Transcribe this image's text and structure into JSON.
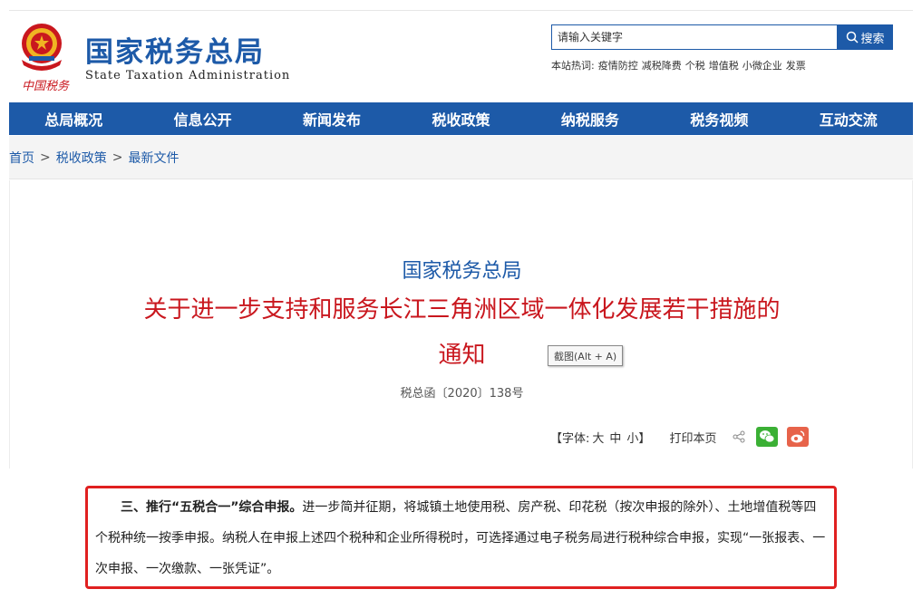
{
  "header": {
    "title_cn": "国家税务总局",
    "title_en": "State Taxation Administration",
    "emblem_caption": "中国税务"
  },
  "search": {
    "placeholder": "请输入关键字",
    "button_label": "搜索",
    "hot_label": "本站热词:",
    "hot_words": [
      "疫情防控",
      "减税降费",
      "个税",
      "增值税",
      "小微企业",
      "发票"
    ]
  },
  "nav": {
    "items": [
      "总局概况",
      "信息公开",
      "新闻发布",
      "税收政策",
      "纳税服务",
      "税务视频",
      "互动交流"
    ]
  },
  "breadcrumb": {
    "items": [
      "首页",
      "税收政策",
      "最新文件"
    ],
    "separator": ">"
  },
  "article": {
    "issuer": "国家税务总局",
    "title": "关于进一步支持和服务长江三角洲区域一体化发展若干措施的通知",
    "doc_number": "税总函〔2020〕138号",
    "tooltip": "截图(Alt + A)"
  },
  "tools": {
    "font_label": "【字体:",
    "font_large": "大",
    "font_medium": "中",
    "font_small": "小】",
    "print_label": "打印本页"
  },
  "excerpt": {
    "heading": "三、推行“五税合一”综合申报。",
    "body": "进一步简并征期，将城镇土地使用税、房产税、印花税（按次申报的除外）、土地增值税等四个税种统一按季申报。纳税人在申报上述四个税种和企业所得税时，可选择通过电子税务局进行税种综合申报，实现“一张报表、一次申报、一次缴款、一张凭证”。"
  },
  "colors": {
    "brand_blue": "#1d5aa8",
    "title_red": "#c9171e",
    "highlight_red": "#e02020"
  }
}
